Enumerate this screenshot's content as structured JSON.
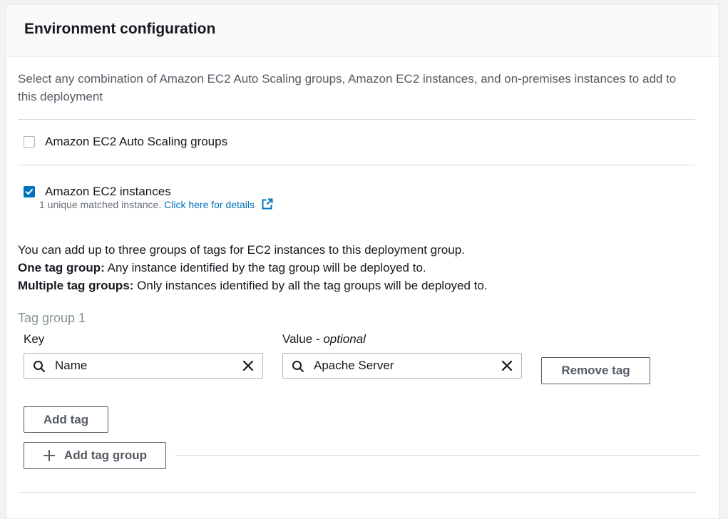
{
  "panel": {
    "title": "Environment configuration",
    "description": "Select any combination of Amazon EC2 Auto Scaling groups, Amazon EC2 instances, and on-premises instances to add to this deployment"
  },
  "options": {
    "asg": {
      "label": "Amazon EC2 Auto Scaling groups",
      "checked": false
    },
    "ec2": {
      "label": "Amazon EC2 instances",
      "checked": true,
      "matched_text": "1 unique matched instance.",
      "details_link": "Click here for details"
    }
  },
  "info": {
    "line1": "You can add up to three groups of tags for EC2 instances to this deployment group.",
    "one_tag_label": "One tag group:",
    "one_tag_text": " Any instance identified by the tag group will be deployed to.",
    "multi_tag_label": "Multiple tag groups:",
    "multi_tag_text": " Only instances identified by all the tag groups will be deployed to."
  },
  "tag_group": {
    "title": "Tag group 1",
    "key_label": "Key",
    "value_label": "Value - ",
    "value_optional": "optional",
    "key_value": "Name",
    "value_value": "Apache Server",
    "remove_tag": "Remove tag",
    "add_tag": "Add tag",
    "add_tag_group": "Add tag group"
  },
  "colors": {
    "accent": "#0073bb",
    "text": "#16191f",
    "muted": "#545b64"
  }
}
